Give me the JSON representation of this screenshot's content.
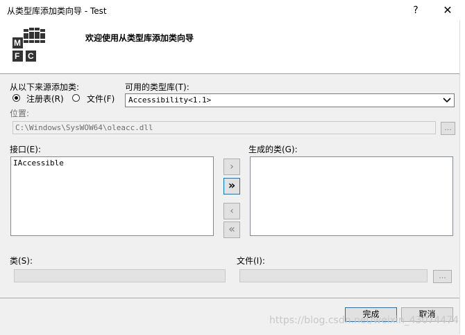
{
  "window": {
    "title": "从类型库添加类向导 - Test",
    "help_glyph": "?",
    "close_glyph": "✕"
  },
  "header": {
    "title": "欢迎使用从类型库添加类向导",
    "logo_letters": [
      "M",
      "F",
      "C"
    ]
  },
  "source": {
    "label": "从以下来源添加类:",
    "options": [
      {
        "label": "注册表(R)",
        "selected": true
      },
      {
        "label": "文件(F)",
        "selected": false
      }
    ]
  },
  "type_library": {
    "label": "可用的类型库(T):",
    "selected": "Accessibility<1.1>"
  },
  "location": {
    "label": "位置:",
    "value": "C:\\Windows\\SysWOW64\\oleacc.dll",
    "browse_label": "..."
  },
  "interfaces": {
    "label": "接口(E):",
    "items": [
      "IAccessible"
    ]
  },
  "generated": {
    "label": "生成的类(G):",
    "items": []
  },
  "transfer_buttons": {
    "add_one": "›",
    "add_all": "»",
    "remove_one": "‹",
    "remove_all": "«"
  },
  "class_field": {
    "label": "类(S):",
    "value": ""
  },
  "file_field": {
    "label": "文件(I):",
    "value": "",
    "browse_label": "..."
  },
  "footer": {
    "finish_label": "完成",
    "cancel_label": "取消",
    "watermark": "https://blog.csdn.net/weixin_43074474"
  },
  "colors": {
    "accent": "#0078d7",
    "dialog_bg": "#f0f0f0"
  }
}
